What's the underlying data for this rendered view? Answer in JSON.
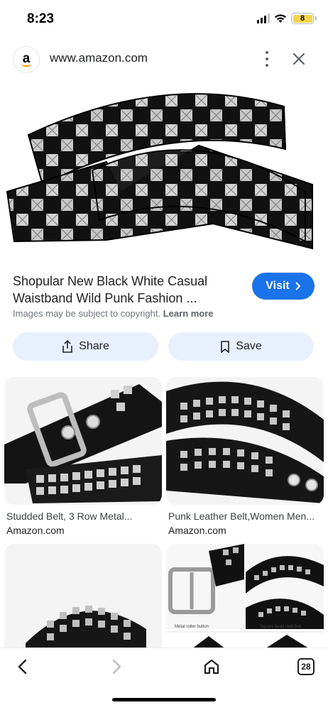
{
  "status_bar": {
    "time": "8:23",
    "battery": "8"
  },
  "header": {
    "url": "www.amazon.com",
    "favicon_letter": "a",
    "more_icon": "more-vert-icon",
    "close_icon": "close-icon"
  },
  "result": {
    "title": "Shopular New Black White Casual Waistband Wild Punk Fashion ...",
    "visit_label": "Visit",
    "copyright_text": "Images may be subject to copyright.",
    "learn_more": "Learn more"
  },
  "actions": {
    "share_label": "Share",
    "save_label": "Save"
  },
  "related": [
    {
      "title": "Studded Belt, 3 Row Metal...",
      "source": "Amazon.com"
    },
    {
      "title": "Punk Leather Belt,Women Men...",
      "source": "Amazon.com"
    },
    {
      "title": "",
      "source": ""
    },
    {
      "title": "",
      "source": ""
    }
  ],
  "related_image_captions": {
    "roller_buckle": "Metal roller button",
    "rivet_belt": "Square bead rivet belt"
  },
  "bottom_nav": {
    "tab_count": "28"
  },
  "colors": {
    "accent": "#1a73e8",
    "chip_bg": "#e8f0fe",
    "amazon_orange": "#ff9900"
  }
}
